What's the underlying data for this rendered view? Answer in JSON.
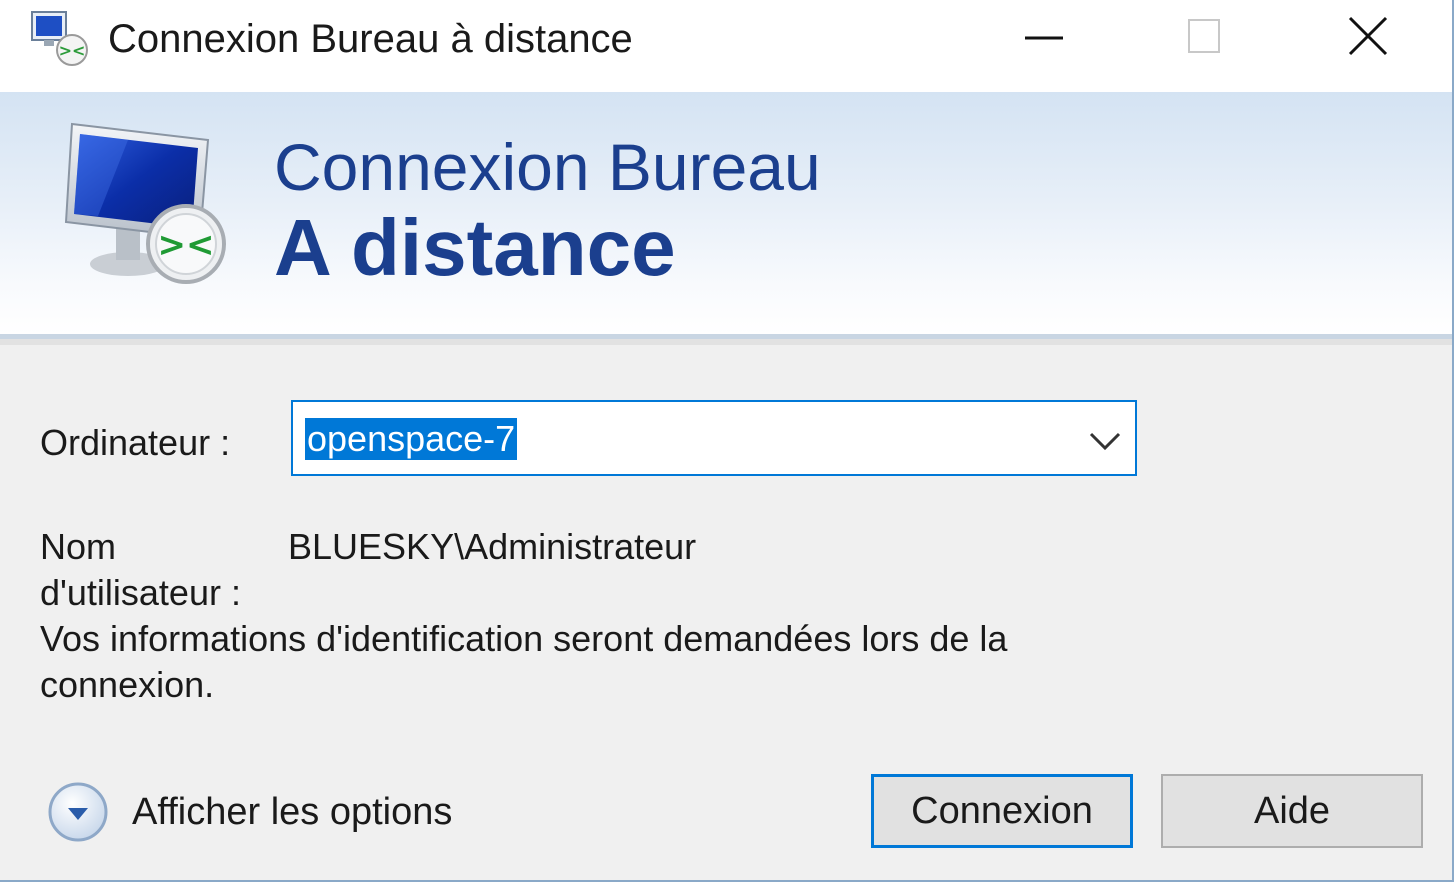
{
  "window": {
    "title": "Connexion Bureau à distance",
    "controls": {
      "minimize": "minimize-icon",
      "maximize": "maximize-icon",
      "close": "close-icon"
    }
  },
  "banner": {
    "line1": "Connexion Bureau",
    "line2": "A distance",
    "icon": "remote-desktop-monitor-icon"
  },
  "form": {
    "computer_label": "Ordinateur :",
    "computer_value": "openspace-7",
    "username_label_line1": "Nom",
    "username_label_line2": "d'utilisateur :",
    "username_value": "BLUESKY\\Administrateur",
    "info_line1": "Vos informations d'identification seront demandées lors de la",
    "info_line2": "connexion."
  },
  "footer": {
    "options_label": "Afficher les options",
    "connect_label": "Connexion",
    "help_label": "Aide"
  },
  "colors": {
    "accent": "#0078d7",
    "banner_text": "#1b3f8e"
  }
}
